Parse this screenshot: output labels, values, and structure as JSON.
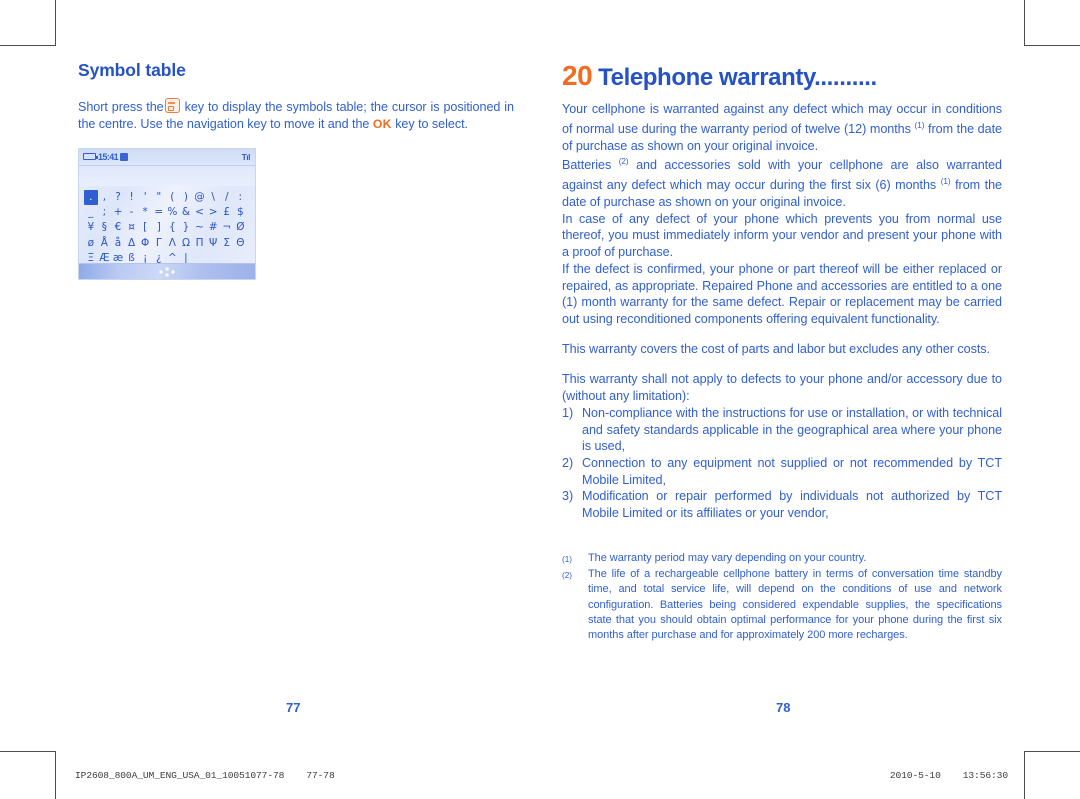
{
  "document": {
    "left_page": {
      "page_number": "77",
      "heading": "Symbol table",
      "intro_before_icon": "Short press the",
      "icon_name": "sym-key-icon",
      "intro_after_icon": "key to display the symbols table; the cursor is positioned in the centre. Use the navigation key to move it and the",
      "ok_key_label": "OK",
      "intro_tail": "key to select.",
      "phone_screenshot": {
        "status_bar": {
          "battery_icon": "battery-icon",
          "time": "15:41",
          "message_icon": "message-icon",
          "signal_icon": "signal-icon",
          "signal_label": "Tıl"
        },
        "symbol_rows": [
          [
            ".",
            ",",
            "?",
            "!",
            "'",
            "\"",
            "(",
            ")",
            "@",
            "\\",
            "/",
            ":"
          ],
          [
            "_",
            ";",
            "+",
            "-",
            "*",
            "=",
            "%",
            "&",
            "<",
            ">",
            "£",
            "$"
          ],
          [
            "¥",
            "§",
            "€",
            "¤",
            "[",
            "]",
            "{",
            "}",
            "~",
            "#",
            "¬",
            "Ø"
          ],
          [
            "ø",
            "Å",
            "å",
            "Δ",
            "Φ",
            "Γ",
            "Λ",
            "Ω",
            "Π",
            "Ψ",
            "Σ",
            "Θ"
          ],
          [
            "Ξ",
            "Æ",
            "æ",
            "ß",
            "¡",
            "¿",
            "^",
            "|",
            "",
            "",
            "",
            ""
          ]
        ],
        "selected_index": {
          "row": 0,
          "col": 0
        },
        "softkey_bar": "navigation-indicator"
      }
    },
    "right_page": {
      "page_number": "78",
      "chapter_number": "20",
      "chapter_title": "Telephone warranty..........",
      "paragraphs": [
        "Your cellphone is warranted against any defect which may occur in conditions of normal use during the warranty period of twelve (12) months (1) from the date of purchase as shown on your original invoice.",
        "Batteries (2) and accessories sold with your cellphone are also warranted against any defect which may occur during the first six (6) months (1) from the date of purchase as shown on your original invoice.",
        "In case of any defect of your phone which prevents you from normal use thereof, you must immediately inform your vendor and present your phone with a proof of purchase.",
        "If the defect is confirmed, your phone or part thereof will be either replaced or repaired, as appropriate. Repaired Phone and accessories are entitled to a one (1) month warranty for the same defect. Repair or replacement may be carried out using reconditioned components offering equivalent functionality."
      ],
      "para_costs": "This warranty covers the cost of parts and labor but excludes any other costs.",
      "para_exclusion_lead": "This warranty shall not apply to defects to your phone and/or accessory due to (without any limitation):",
      "exclusions": [
        {
          "marker": "1)",
          "text": "Non-compliance with the instructions for use or installation, or with technical and safety standards applicable in the geographical area where your phone is used,"
        },
        {
          "marker": "2)",
          "text": "Connection to any equipment not supplied or not recommended by TCT Mobile Limited,"
        },
        {
          "marker": "3)",
          "text": "Modification or repair performed by individuals not authorized by TCT Mobile Limited or its affiliates or your vendor,"
        }
      ],
      "footnotes": [
        {
          "marker": "(1)",
          "text": "The warranty period may vary depending on your country."
        },
        {
          "marker": "(2)",
          "text": "The life of a rechargeable cellphone battery in terms of conversation time standby time, and total service life, will depend on the conditions of use and network configuration. Batteries being considered expendable supplies, the specifications state that you should obtain optimal performance for your phone during the first six months after purchase and for approximately 200 more recharges."
        }
      ]
    }
  },
  "print_footer": {
    "file_reference": "IP2608_800A_UM_ENG_USA_01_10051077-78",
    "page_range": "77-78",
    "date": "2010-5-10",
    "time": "13:56:30"
  },
  "colors": {
    "body_blue": "#2f5fd0",
    "heading_blue": "#2552c4",
    "accent_orange": "#f26c21",
    "crop_mark": "#4d4d4d"
  }
}
